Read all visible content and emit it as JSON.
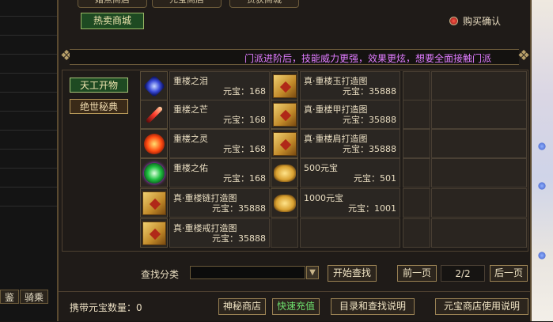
{
  "left_panel": {
    "tabs": [
      "鉴",
      "骑乘"
    ]
  },
  "top_tabs": [
    "婚点商店",
    "元宝商店",
    "货获商城"
  ],
  "hot_tab": "热卖商城",
  "purchase_confirm": "购买确认",
  "notice": "门派进阶后，技能威力更强，效果更炫，想要全面接触门派",
  "categories": [
    "天工开物",
    "绝世秘典"
  ],
  "items": [
    {
      "name": "重楼之泪",
      "price": "元宝：168",
      "icon": "blue-crystal-icon"
    },
    {
      "name": "真·重楼玉打造图",
      "price": "元宝：35888",
      "icon": "scroll-icon"
    },
    {
      "name": "重楼之芒",
      "price": "元宝：168",
      "icon": "red-feather-icon"
    },
    {
      "name": "真·重楼甲打造图",
      "price": "元宝：35888",
      "icon": "scroll-icon"
    },
    {
      "name": "重楼之灵",
      "price": "元宝：168",
      "icon": "red-orb-icon"
    },
    {
      "name": "真·重楼肩打造图",
      "price": "元宝：35888",
      "icon": "scroll-icon"
    },
    {
      "name": "重楼之佑",
      "price": "元宝：168",
      "icon": "green-orb-icon"
    },
    {
      "name": "500元宝",
      "price": "元宝：501",
      "icon": "gold-ingot-icon"
    },
    {
      "name": "真·重楼链打造图",
      "price": "元宝：35888",
      "icon": "scroll-icon"
    },
    {
      "name": "1000元宝",
      "price": "元宝：1001",
      "icon": "gold-ingot-icon"
    },
    {
      "name": "真·重楼戒打造图",
      "price": "元宝：35888",
      "icon": "scroll-icon"
    }
  ],
  "search": {
    "label": "查找分类",
    "value": "",
    "button": "开始查找"
  },
  "pagination": {
    "prev": "前一页",
    "indicator": "2/2",
    "next": "后一页"
  },
  "footer": {
    "carry_label": "携带元宝数量：",
    "carry_value": "0",
    "mystery_shop": "神秘商店",
    "quick_recharge": "快速充值",
    "catalog_help": "目录和查找说明",
    "shop_help": "元宝商店使用说明"
  }
}
